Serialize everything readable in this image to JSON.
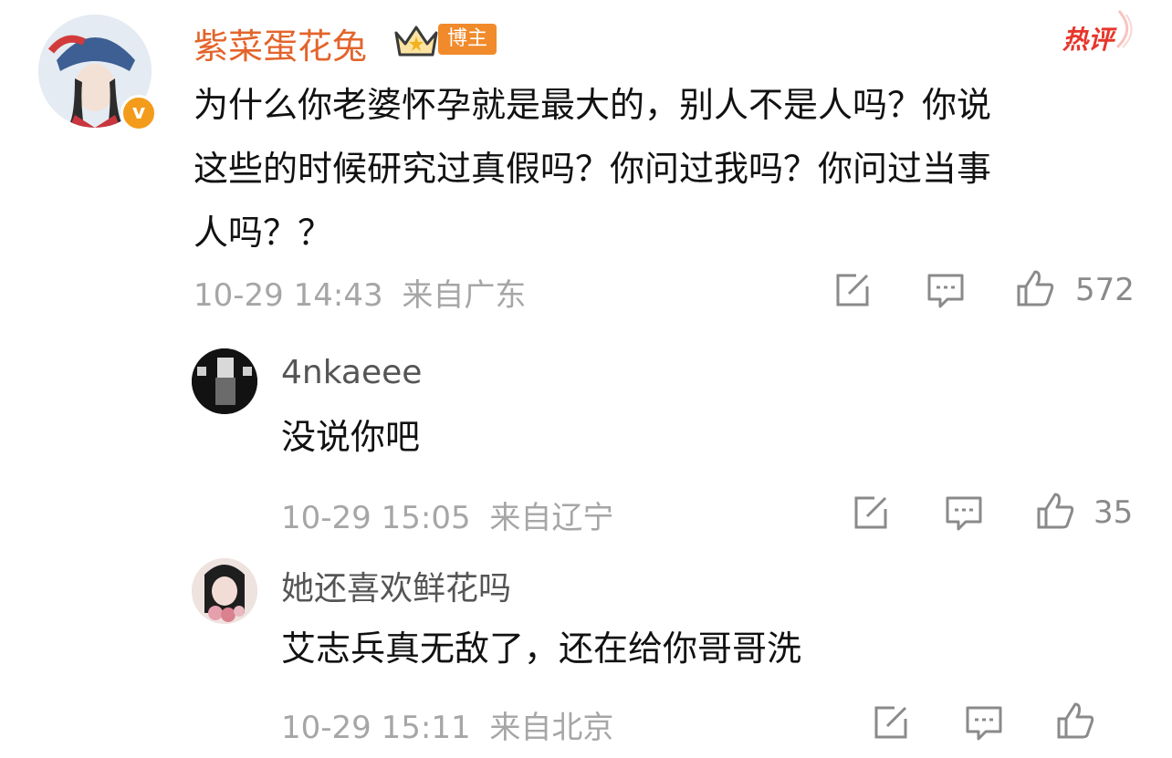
{
  "hot_label": "热评",
  "main_comment": {
    "username": "紫菜蛋花兔",
    "host_badge": "博主",
    "text_lines": [
      "为什么你老婆怀孕就是最大的，别人不是人吗？你说",
      "这些的时候研究过真假吗？你问过我吗？你问过当事",
      "人吗？？"
    ],
    "date": "10-29 14:43",
    "location": "来自广东",
    "like_count": "572"
  },
  "replies": [
    {
      "username": "4nkaeee",
      "text": "没说你吧",
      "date": "10-29 15:05",
      "location": "来自辽宁",
      "like_count": "35"
    },
    {
      "username": "她还喜欢鲜花吗",
      "text": "艾志兵真无敌了，还在给你哥哥洗",
      "date": "10-29 15:11",
      "location": "来自北京"
    }
  ],
  "icons": {
    "repost": "share-edit-icon",
    "comment": "comment-icon",
    "like": "thumbs-up-icon",
    "crown": "crown-icon",
    "verified": "verified-v-icon"
  },
  "colors": {
    "username": "#e3642b",
    "host_badge": "#f08a2b",
    "hot": "#e8352b",
    "verified": "#f39b1b",
    "meta": "#a6a6a6"
  }
}
